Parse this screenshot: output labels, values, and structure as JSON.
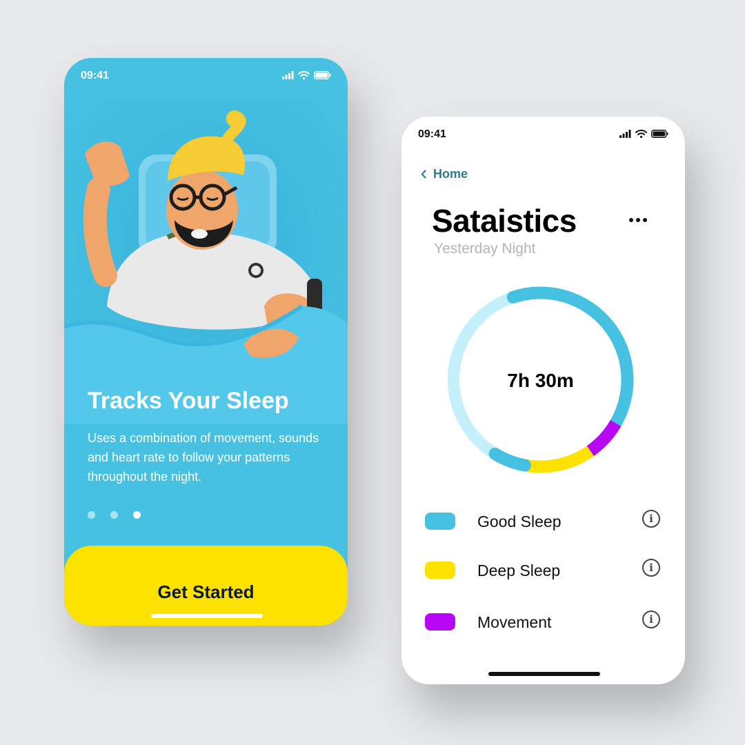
{
  "onboarding": {
    "status": {
      "time": "09:41"
    },
    "title": "Tracks Your Sleep",
    "body": "Uses a combination of movement, sounds and heart rate to follow your patterns throughout the night.",
    "pagination": {
      "count": 3,
      "active": 3
    },
    "cta_label": "Get Started",
    "colors": {
      "background": "#46c1e2",
      "cta": "#fde200"
    }
  },
  "statistics": {
    "status": {
      "time": "09:41"
    },
    "back_label": "Home",
    "title": "Sataistics",
    "subtitle": "Yesterday Night",
    "total_sleep": "7h 30m",
    "legend": [
      {
        "label": "Good Sleep",
        "color": "#46c1e2"
      },
      {
        "label": "Deep Sleep",
        "color": "#fde200"
      },
      {
        "label": "Movement",
        "color": "#b707f5"
      }
    ],
    "ring_track_color": "#c3f0fb",
    "icons": {
      "back": "chevron-left-icon",
      "more": "more-horizontal-icon",
      "info": "info-icon"
    }
  }
}
